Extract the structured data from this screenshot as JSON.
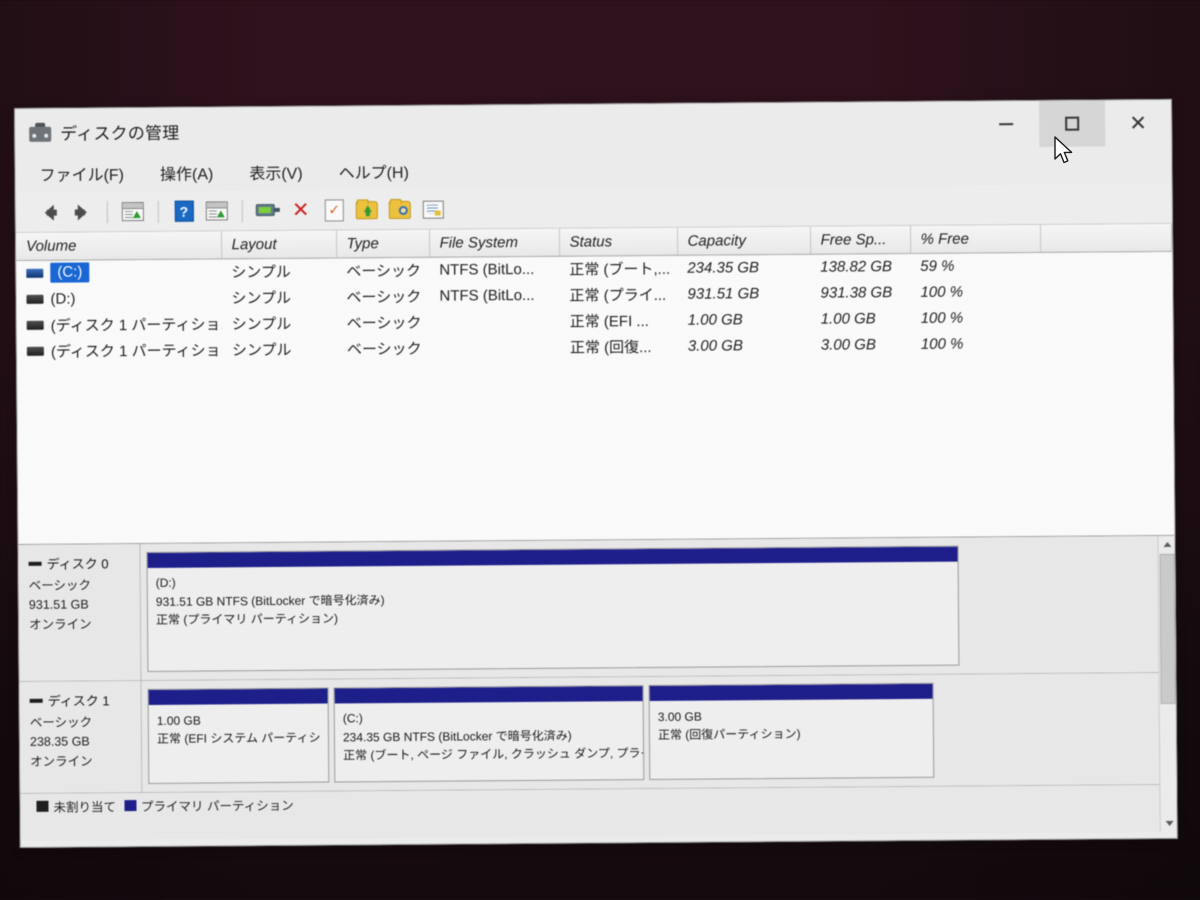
{
  "window": {
    "title": "ディスクの管理",
    "icon": "disk-management-icon",
    "controls": {
      "minimize": "−",
      "maximize": "□",
      "close": "✕"
    }
  },
  "menu": [
    {
      "label": "ファイル(F)",
      "name": "menu-file"
    },
    {
      "label": "操作(A)",
      "name": "menu-action"
    },
    {
      "label": "表示(V)",
      "name": "menu-view"
    },
    {
      "label": "ヘルプ(H)",
      "name": "menu-help"
    }
  ],
  "toolbar": [
    {
      "name": "back-arrow-icon"
    },
    {
      "name": "forward-arrow-icon"
    },
    {
      "name": "show-hide-console-tree-icon"
    },
    {
      "name": "help-icon"
    },
    {
      "name": "show-hide-action-pane-icon"
    },
    {
      "name": "rescan-disks-icon"
    },
    {
      "name": "delete-icon"
    },
    {
      "name": "properties-check-icon"
    },
    {
      "name": "folder-up-icon"
    },
    {
      "name": "folder-search-icon"
    },
    {
      "name": "list-properties-icon"
    }
  ],
  "volume_list": {
    "columns": [
      "Volume",
      "Layout",
      "Type",
      "File System",
      "Status",
      "Capacity",
      "Free Sp...",
      "% Free"
    ],
    "rows": [
      {
        "volume": "(C:)",
        "selected": true,
        "layout": "シンプル",
        "type": "ベーシック",
        "file_system": "NTFS (BitLo...",
        "status": "正常 (ブート,...",
        "capacity": "234.35 GB",
        "free_space": "138.82 GB",
        "percent_free": "59 %"
      },
      {
        "volume": "(D:)",
        "selected": false,
        "layout": "シンプル",
        "type": "ベーシック",
        "file_system": "NTFS (BitLo...",
        "status": "正常 (プライ...",
        "capacity": "931.51 GB",
        "free_space": "931.38 GB",
        "percent_free": "100 %"
      },
      {
        "volume": "(ディスク 1 パーティショ...",
        "selected": false,
        "layout": "シンプル",
        "type": "ベーシック",
        "file_system": "",
        "status": "正常 (EFI ...",
        "capacity": "1.00 GB",
        "free_space": "1.00 GB",
        "percent_free": "100 %"
      },
      {
        "volume": "(ディスク 1 パーティショ...",
        "selected": false,
        "layout": "シンプル",
        "type": "ベーシック",
        "file_system": "",
        "status": "正常 (回復...",
        "capacity": "3.00 GB",
        "free_space": "3.00 GB",
        "percent_free": "100 %"
      }
    ]
  },
  "disks": [
    {
      "name": "ディスク 0",
      "type": "ベーシック",
      "size": "931.51 GB",
      "state": "オンライン",
      "partitions": [
        {
          "label": "(D:)",
          "line2": "931.51 GB NTFS (BitLocker で暗号化済み)",
          "line3": "正常 (プライマリ パーティション)",
          "width_pct": 100,
          "kind": "primary"
        }
      ]
    },
    {
      "name": "ディスク 1",
      "type": "ベーシック",
      "size": "238.35 GB",
      "state": "オンライン",
      "partitions": [
        {
          "label": "",
          "line2": "1.00 GB",
          "line3": "正常 (EFI システム パーティシ",
          "width_pct": 22,
          "kind": "primary"
        },
        {
          "label": "(C:)",
          "line2": "234.35 GB NTFS (BitLocker で暗号化済み)",
          "line3": "正常 (ブート, ページ ファイル, クラッシュ ダンプ, プライマ",
          "width_pct": 38,
          "kind": "primary"
        },
        {
          "label": "",
          "line2": "3.00 GB",
          "line3": "正常 (回復パーティション)",
          "width_pct": 27,
          "kind": "primary"
        }
      ]
    }
  ],
  "legend": [
    {
      "swatch": "unalloc",
      "label": "未割り当て"
    },
    {
      "swatch": "primary",
      "label": "プライマリ パーティション"
    }
  ],
  "colors": {
    "accent_selection": "#1565d8",
    "partition_header": "#1a1a8c",
    "unallocated": "#1a1a1a",
    "wallpaper": "#c45272"
  }
}
